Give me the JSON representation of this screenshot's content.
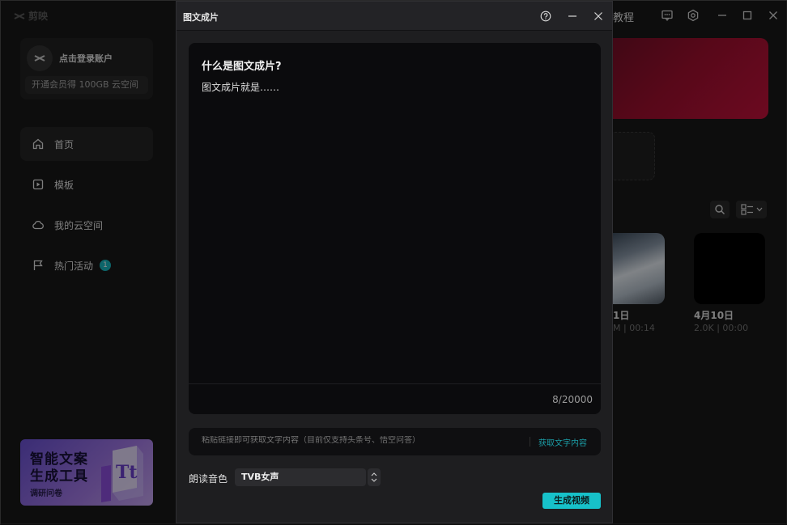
{
  "app": {
    "logo_text": "剪映",
    "tutorial_label": "教程"
  },
  "sidebar": {
    "account": {
      "name": "点击登录账户",
      "vip_text": "开通会员得 100GB 云空间"
    },
    "items": [
      {
        "label": "首页",
        "icon": "home-icon",
        "active": true
      },
      {
        "label": "模板",
        "icon": "template-icon",
        "active": false
      },
      {
        "label": "我的云空间",
        "icon": "cloud-icon",
        "active": false
      },
      {
        "label": "热门活动",
        "icon": "flag-icon",
        "active": false,
        "badge": "1"
      }
    ],
    "banner": {
      "line1": "智能文案",
      "line2": "生成工具",
      "line3": "调研问卷",
      "art_glyph": "Tt"
    }
  },
  "projects": [
    {
      "title": "1日",
      "meta": "M | 00:14"
    },
    {
      "title": "4月10日",
      "meta": "2.0K | 00:00"
    }
  ],
  "modal": {
    "title": "图文成片",
    "editor": {
      "heading": "什么是图文成片?",
      "body": "图文成片就是……",
      "count": "8/20000"
    },
    "link_bar": {
      "placeholder": "粘贴链接即可获取文字内容（目前仅支持头条号、悟空问答）",
      "fetch_label": "获取文字内容"
    },
    "voice": {
      "label": "朗读音色",
      "selected": "TVB女声"
    },
    "generate_label": "生成视频"
  },
  "colors": {
    "accent": "#17c1c9",
    "badge": "#19b8c2",
    "hero_red": "#c5123c"
  }
}
